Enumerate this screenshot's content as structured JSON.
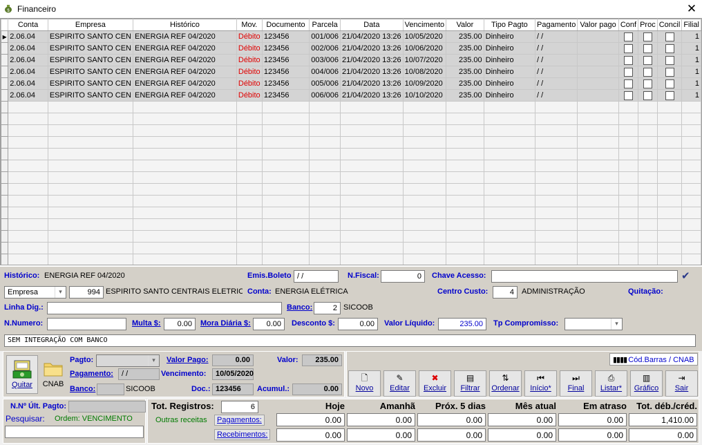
{
  "window": {
    "title": "Financeiro"
  },
  "grid": {
    "columns": [
      "Conta",
      "Empresa",
      "Histórico",
      "Mov.",
      "Documento",
      "Parcela",
      "Data",
      "Vencimento",
      "Valor",
      "Tipo Pagto",
      "Pagamento",
      "Valor pago",
      "Conf",
      "Proc",
      "Concil",
      "Filial"
    ],
    "rows": [
      {
        "conta": "2.06.04",
        "empresa": "ESPIRITO SANTO CEN",
        "historico": "ENERGIA REF 04/2020",
        "mov": "Débito",
        "documento": "123456",
        "parcela": "001/006",
        "data": "21/04/2020 13:26",
        "vencimento": "10/05/2020",
        "valor": "235.00",
        "tipo": "Dinheiro",
        "pagamento": "/ /",
        "valor_pago": "",
        "filial": "1"
      },
      {
        "conta": "2.06.04",
        "empresa": "ESPIRITO SANTO CEN",
        "historico": "ENERGIA REF 04/2020",
        "mov": "Débito",
        "documento": "123456",
        "parcela": "002/006",
        "data": "21/04/2020 13:26",
        "vencimento": "10/06/2020",
        "valor": "235.00",
        "tipo": "Dinheiro",
        "pagamento": "/ /",
        "valor_pago": "",
        "filial": "1"
      },
      {
        "conta": "2.06.04",
        "empresa": "ESPIRITO SANTO CEN",
        "historico": "ENERGIA REF 04/2020",
        "mov": "Débito",
        "documento": "123456",
        "parcela": "003/006",
        "data": "21/04/2020 13:26",
        "vencimento": "10/07/2020",
        "valor": "235.00",
        "tipo": "Dinheiro",
        "pagamento": "/ /",
        "valor_pago": "",
        "filial": "1"
      },
      {
        "conta": "2.06.04",
        "empresa": "ESPIRITO SANTO CEN",
        "historico": "ENERGIA REF 04/2020",
        "mov": "Débito",
        "documento": "123456",
        "parcela": "004/006",
        "data": "21/04/2020 13:26",
        "vencimento": "10/08/2020",
        "valor": "235.00",
        "tipo": "Dinheiro",
        "pagamento": "/ /",
        "valor_pago": "",
        "filial": "1"
      },
      {
        "conta": "2.06.04",
        "empresa": "ESPIRITO SANTO CEN",
        "historico": "ENERGIA REF 04/2020",
        "mov": "Débito",
        "documento": "123456",
        "parcela": "005/006",
        "data": "21/04/2020 13:26",
        "vencimento": "10/09/2020",
        "valor": "235.00",
        "tipo": "Dinheiro",
        "pagamento": "/ /",
        "valor_pago": "",
        "filial": "1"
      },
      {
        "conta": "2.06.04",
        "empresa": "ESPIRITO SANTO CEN",
        "historico": "ENERGIA REF 04/2020",
        "mov": "Débito",
        "documento": "123456",
        "parcela": "006/006",
        "data": "21/04/2020 13:26",
        "vencimento": "10/10/2020",
        "valor": "235.00",
        "tipo": "Dinheiro",
        "pagamento": "/ /",
        "valor_pago": "",
        "filial": "1"
      }
    ],
    "empty_rows": 15
  },
  "detail": {
    "historico_label": "Histórico:",
    "historico_value": "ENERGIA REF 04/2020",
    "emis_boleto_label": "Emis.Boleto",
    "emis_boleto_value": "/ /",
    "nfiscal_label": "N.Fiscal:",
    "nfiscal_value": "0",
    "chave_label": "Chave Acesso:",
    "chave_value": "",
    "empresa_select": "Empresa",
    "empresa_code": "994",
    "empresa_name": "ESPIRITO SANTO CENTRAIS ELETRICAS S.A.- E",
    "conta_label": "Conta:",
    "conta_value": "ENERGIA ELÉTRICA",
    "centro_label": "Centro Custo:",
    "centro_code": "4",
    "centro_name": "ADMINISTRAÇÃO",
    "quitacao_label": "Quitação:",
    "linha_label": "Linha Dig.:",
    "linha_value": "",
    "banco_label": "Banco:",
    "banco_code": "2",
    "banco_name": "SICOOB",
    "nnumero_label": "N.Numero:",
    "nnumero_value": "",
    "multa_label": "Multa $:",
    "multa_value": "0.00",
    "mora_label": "Mora Diária $:",
    "mora_value": "0.00",
    "desconto_label": "Desconto $:",
    "desconto_value": "0.00",
    "liquido_label": "Valor Líquido:",
    "liquido_value": "235.00",
    "tpcomp_label": "Tp Compromisso:",
    "tpcomp_value": "",
    "obs_value": "SEM INTEGRAÇÃO COM BANCO"
  },
  "payment": {
    "quitar_label": "Quitar",
    "cnab_label": "CNAB",
    "pagto_label": "Pagto:",
    "pagto_value": "",
    "pagamento_label": "Pagamento:",
    "pagamento_value": "/ /",
    "banco_label": "Banco:",
    "banco_value": "SICOOB",
    "valor_pago_label": "Valor Pago:",
    "valor_pago_value": "0.00",
    "vencimento_label": "Vencimento:",
    "vencimento_value": "10/05/2020",
    "doc_label": "Doc.:",
    "doc_value": "123456",
    "valor_label": "Valor:",
    "valor_value": "235.00",
    "acumul_label": "Acumul.:",
    "acumul_value": "0.00"
  },
  "toolbar": {
    "codbarras": "Cód.Barras / CNAB",
    "buttons": [
      {
        "label": "Novo",
        "icon": "new-document-icon",
        "glyph": "🗋"
      },
      {
        "label": "Editar",
        "icon": "edit-icon",
        "glyph": "✎"
      },
      {
        "label": "Excluir",
        "icon": "delete-icon",
        "glyph": "✖"
      },
      {
        "label": "Filtrar",
        "icon": "filter-icon",
        "glyph": "▤"
      },
      {
        "label": "Ordenar",
        "icon": "sort-icon",
        "glyph": "⇅"
      },
      {
        "label": "Início*",
        "icon": "first-icon",
        "glyph": "⏮"
      },
      {
        "label": "Final",
        "icon": "last-icon",
        "glyph": "⏭"
      },
      {
        "label": "Listar*",
        "icon": "print-icon",
        "glyph": "⎙"
      },
      {
        "label": "Gráfico",
        "icon": "chart-icon",
        "glyph": "▥"
      },
      {
        "label": "Sair",
        "icon": "exit-icon",
        "glyph": "⇥"
      }
    ]
  },
  "footer": {
    "ult_pagto_label": "N.Nº Últ. Pagto:",
    "ult_pagto_value": "",
    "pesquisar_label": "Pesquisar:",
    "ordem_label": "Ordem: VENCIMENTO",
    "search_value": "",
    "tot_registros_label": "Tot. Registros:",
    "tot_registros_value": "6",
    "outras_label": "Outras receitas",
    "pagamentos_btn": "Pagamentos:",
    "recebimentos_btn": "Recebimentos:",
    "headers": [
      "Hoje",
      "Amanhã",
      "Próx. 5 dias",
      "Mês atual",
      "Em atraso",
      "Tot. déb./créd."
    ],
    "pagamentos": [
      "0.00",
      "0.00",
      "0.00",
      "0.00",
      "0.00",
      "1,410.00"
    ],
    "recebimentos": [
      "0.00",
      "0.00",
      "0.00",
      "0.00",
      "0.00",
      "0.00"
    ]
  }
}
